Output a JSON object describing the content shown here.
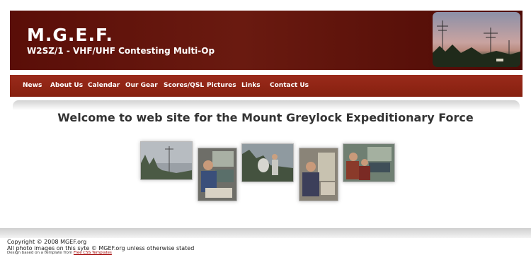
{
  "header": {
    "title": "M.G.E.F.",
    "subtitle": "W2SZ/1 - VHF/UHF Contesting Multi-Op"
  },
  "nav": {
    "items": [
      "News",
      "About Us",
      "Calendar",
      "Our Gear",
      "Scores/QSL",
      "Pictures",
      "Links",
      "Contact Us"
    ]
  },
  "main": {
    "welcome": "Welcome to web site for the Mount Greylock Expeditionary Force"
  },
  "footer": {
    "copyright": "Copyright © 2008 MGEF.org",
    "photos_notice": "All photo images on this syte © MGEF.org unless otherwise stated",
    "design_credit_prefix": "Design based on a template from",
    "design_credit_link": "Free CSS Templates"
  },
  "colors": {
    "header_bg": "#5a0e08",
    "nav_bg": "#8f2414",
    "link": "#a00000"
  }
}
